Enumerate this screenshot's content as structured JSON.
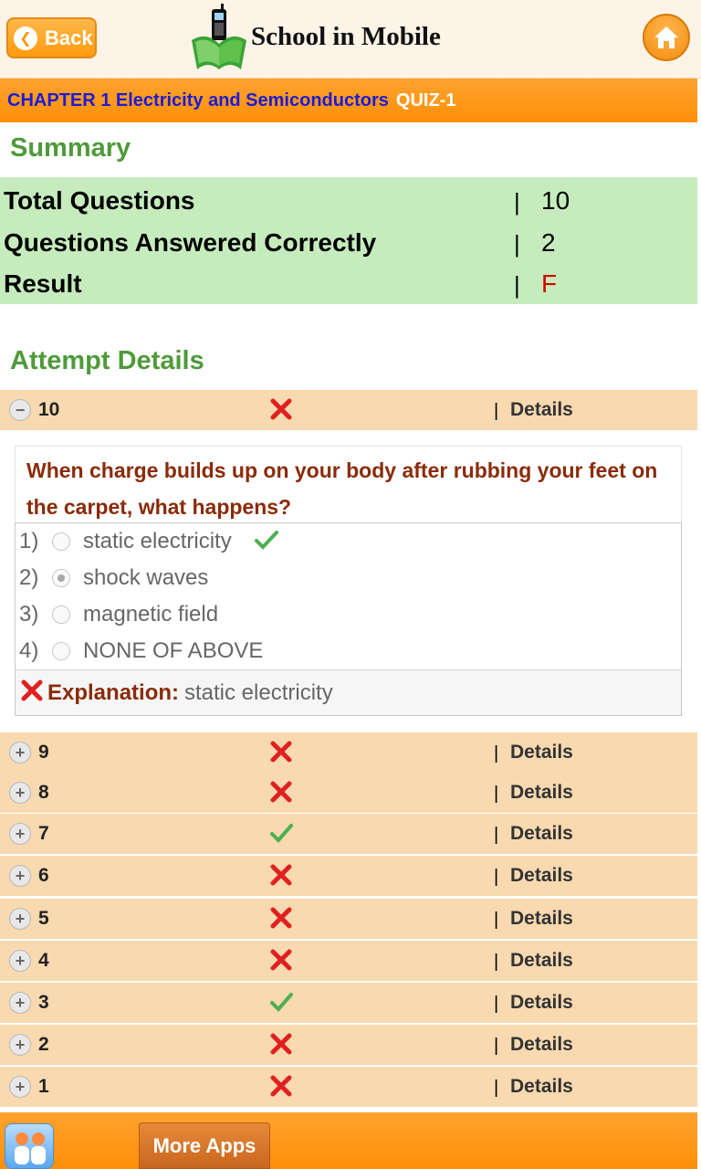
{
  "header": {
    "back_label": "Back",
    "app_title": "School in Mobile",
    "logo_icon": "phone-book-logo-icon",
    "home_icon": "home-icon"
  },
  "chapter": {
    "title": "CHAPTER 1 Electricity and Semiconductors",
    "quiz": "QUIZ-1"
  },
  "summary": {
    "title": "Summary",
    "rows": [
      {
        "label": "Total Questions",
        "sep": "|",
        "value": "10"
      },
      {
        "label": "Questions Answered Correctly",
        "sep": "|",
        "value": "2"
      },
      {
        "label": "Result",
        "sep": "|",
        "value": "F",
        "value_color": "#d40000"
      }
    ]
  },
  "attempts": {
    "title": "Attempt Details",
    "details_label": "Details",
    "sep": "|",
    "rows": [
      {
        "num": "10",
        "status": "wrong",
        "expanded": true
      },
      {
        "num": "9",
        "status": "wrong",
        "expanded": false
      },
      {
        "num": "8",
        "status": "wrong",
        "expanded": false
      },
      {
        "num": "7",
        "status": "correct",
        "expanded": false
      },
      {
        "num": "6",
        "status": "wrong",
        "expanded": false
      },
      {
        "num": "5",
        "status": "wrong",
        "expanded": false
      },
      {
        "num": "4",
        "status": "wrong",
        "expanded": false
      },
      {
        "num": "3",
        "status": "correct",
        "expanded": false
      },
      {
        "num": "2",
        "status": "wrong",
        "expanded": false
      },
      {
        "num": "1",
        "status": "wrong",
        "expanded": false
      }
    ]
  },
  "question": {
    "text": "When charge builds up on your body after rubbing your feet on the carpet, what happens?",
    "options": [
      {
        "num": "1)",
        "text": "static electricity",
        "selected": false,
        "correct": true
      },
      {
        "num": "2)",
        "text": "shock waves",
        "selected": true,
        "correct": false
      },
      {
        "num": "3)",
        "text": "magnetic field",
        "selected": false,
        "correct": false
      },
      {
        "num": "4)",
        "text": "NONE OF ABOVE",
        "selected": false,
        "correct": false
      }
    ],
    "explanation_label": "Explanation:",
    "explanation_text": "static electricity"
  },
  "footer": {
    "more_apps_label": "More Apps",
    "app_icon": "people-icon"
  },
  "colors": {
    "accent_orange": "#ff9a10",
    "summary_green": "#c6ecbe",
    "row_peach": "#f8d9b0",
    "wrong_red": "#e02020",
    "correct_green": "#4caf50"
  }
}
